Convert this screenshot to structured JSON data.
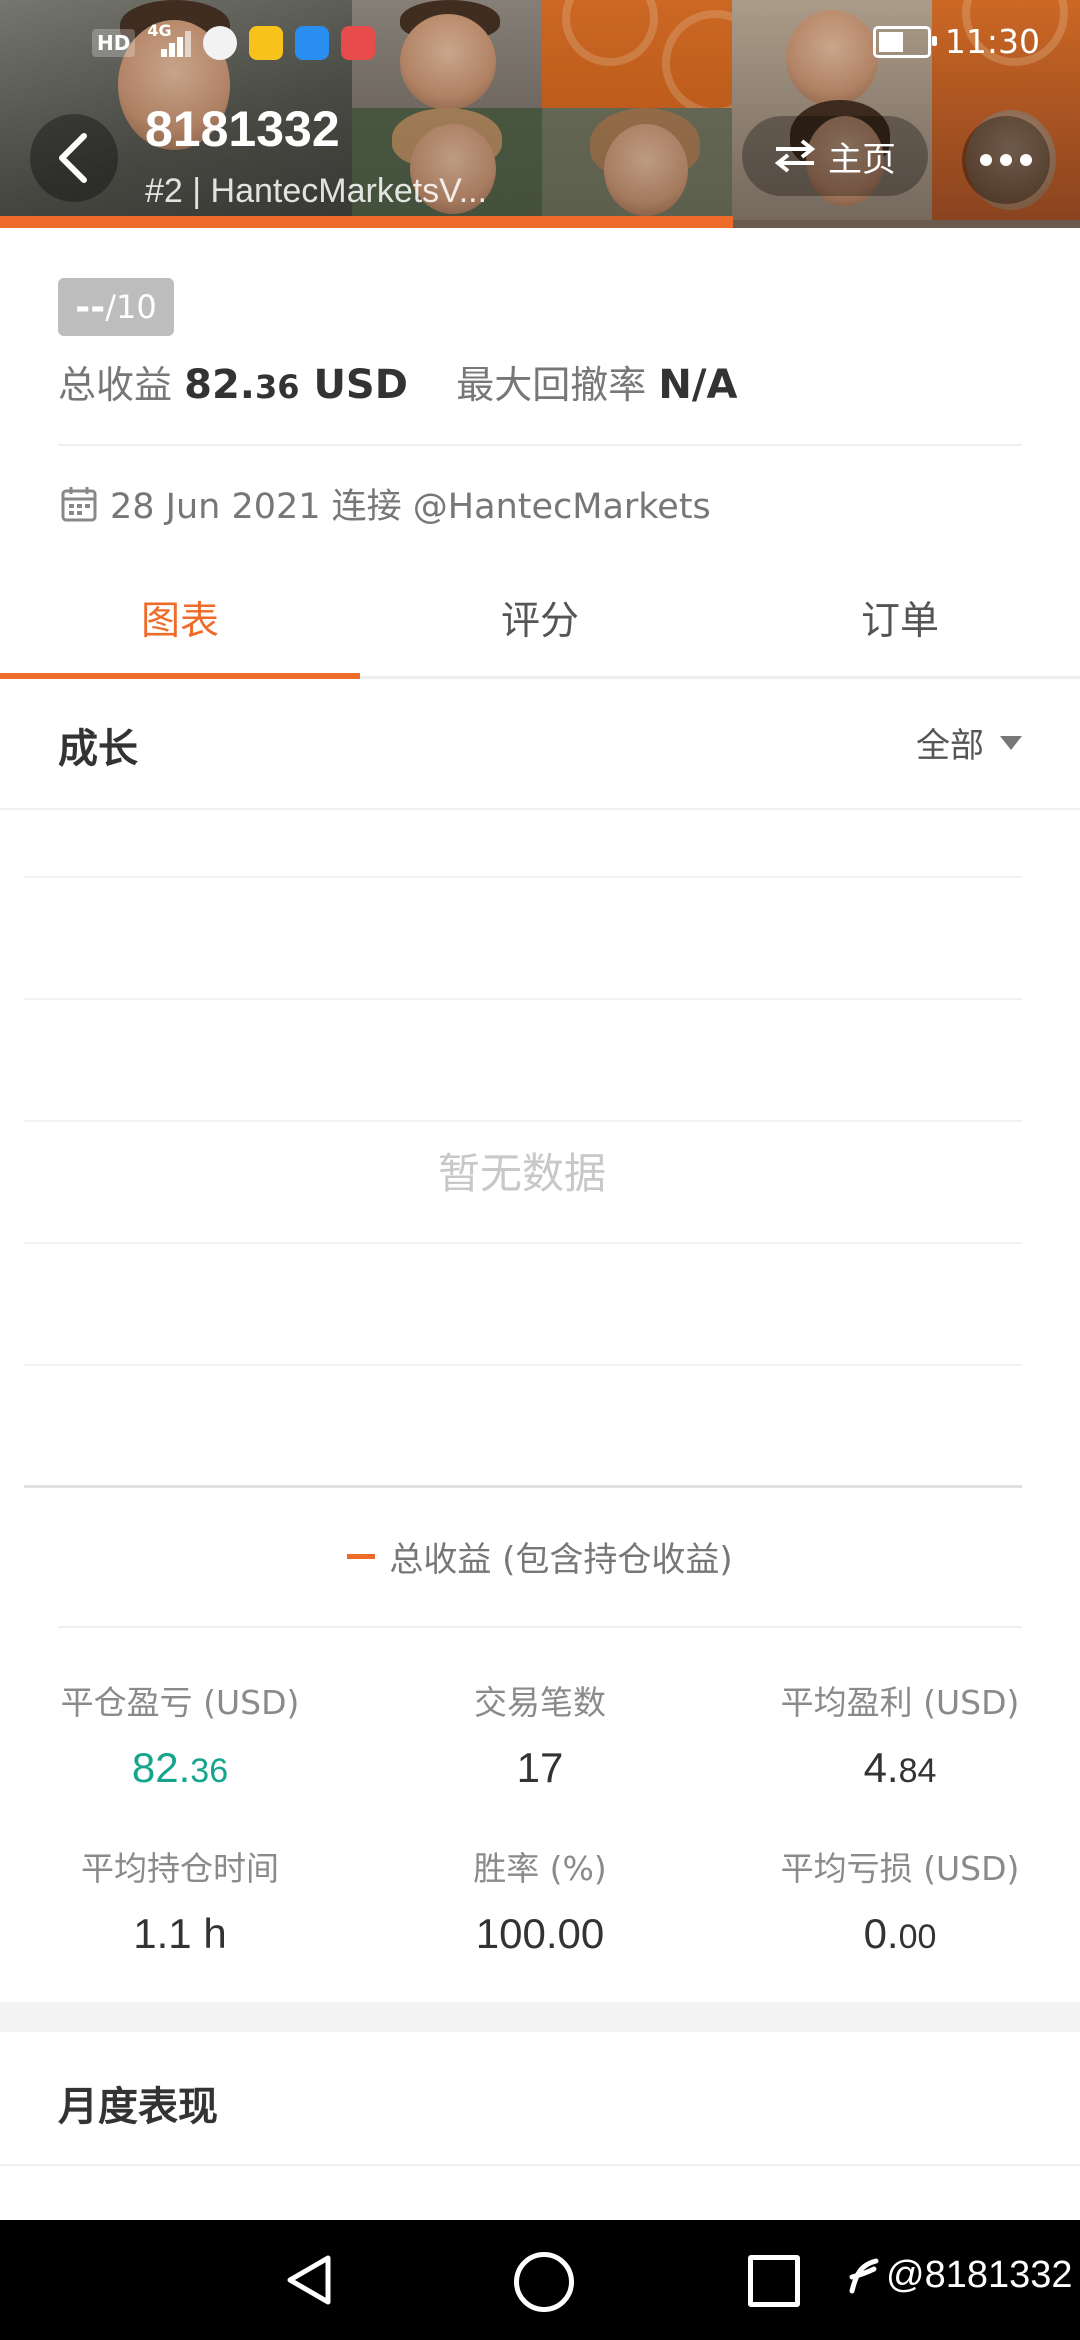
{
  "status_bar": {
    "hd_badge": "HD",
    "network": "4G",
    "time": "11:30"
  },
  "header": {
    "account_id": "8181332",
    "subtitle": "#2 | HantecMarketsV...",
    "home_label": "主页"
  },
  "summary": {
    "score_value": "--",
    "score_max": "/10",
    "total_profit_label": "总收益",
    "total_profit_int": "82.",
    "total_profit_dec": "36",
    "total_profit_unit": "USD",
    "max_drawdown_label": "最大回撤率",
    "max_drawdown_value": "N/A"
  },
  "connection": {
    "text": "28 Jun 2021 连接 @HantecMarkets"
  },
  "tabs": [
    {
      "label": "图表",
      "active": true
    },
    {
      "label": "评分",
      "active": false
    },
    {
      "label": "订单",
      "active": false
    }
  ],
  "growth": {
    "title": "成长",
    "range_label": "全部",
    "no_data": "暂无数据",
    "legend": "总收益 (包含持仓收益)"
  },
  "chart_data": {
    "type": "line",
    "title": "成长",
    "series": [
      {
        "name": "总收益 (包含持仓收益)",
        "values": []
      }
    ],
    "note": "暂无数据"
  },
  "stats": [
    {
      "label": "平仓盈亏 (USD)",
      "int": "82.",
      "dec": "36",
      "highlight": true
    },
    {
      "label": "交易笔数",
      "int": "17",
      "dec": ""
    },
    {
      "label": "平均盈利 (USD)",
      "int": "4.",
      "dec": "84"
    },
    {
      "label": "平均持仓时间",
      "int": "1.1 h",
      "dec": ""
    },
    {
      "label": "胜率 (%)",
      "int": "100.00",
      "dec": ""
    },
    {
      "label": "平均亏损 (USD)",
      "int": "0.",
      "dec": "00"
    }
  ],
  "monthly": {
    "title": "月度表现"
  },
  "watermark": "@8181332",
  "colors": {
    "accent": "#ef6b2a",
    "positive": "#15a58c"
  }
}
